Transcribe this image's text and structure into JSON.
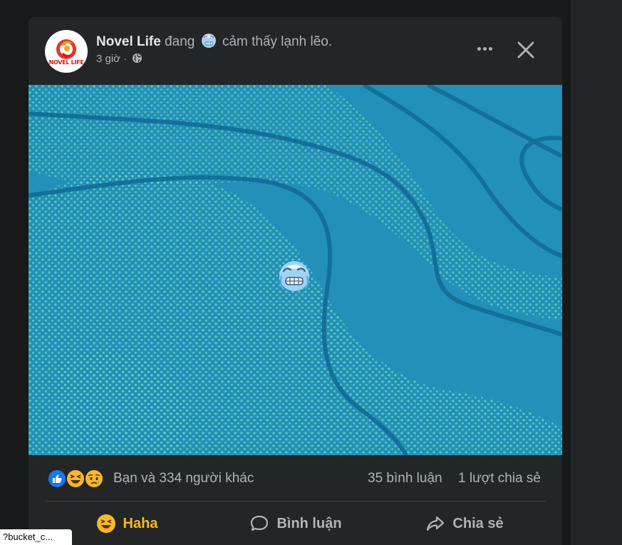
{
  "post": {
    "page_name": "Novel Life",
    "avatar_logo_text": "NOVEL LIFE",
    "feeling_prefix": "đang",
    "feeling_emoji_icon": "cold-face-icon",
    "feeling_text": "cảm thấy lạnh lẽo.",
    "time": "3 giờ ·",
    "privacy_icon": "globe-icon",
    "media": {
      "background_color": "#2290b8",
      "dot_color": "#6ed6b6",
      "line_color": "#13709b",
      "emoji_icon": "cold-face-icon"
    }
  },
  "header_actions": {
    "more_icon": "more-horizontal-icon",
    "close_icon": "close-icon"
  },
  "stats": {
    "reaction_icons": [
      "like-reaction-icon",
      "haha-reaction-icon",
      "sad-reaction-icon"
    ],
    "reaction_summary": "Bạn và 334 người khác",
    "comments": "35 bình luận",
    "shares": "1 lượt chia sẻ"
  },
  "actions": {
    "haha_label": "Haha",
    "comment_label": "Bình luận",
    "share_label": "Chia sẻ"
  },
  "status_bar": {
    "url_text": "?bucket_c..."
  },
  "colors": {
    "page_bg": "#18191a",
    "card_bg": "#242526",
    "primary_text": "#e4e6eb",
    "secondary_text": "#b0b3b8",
    "haha_color": "#f7b928",
    "like_blue": "#1877f2"
  }
}
